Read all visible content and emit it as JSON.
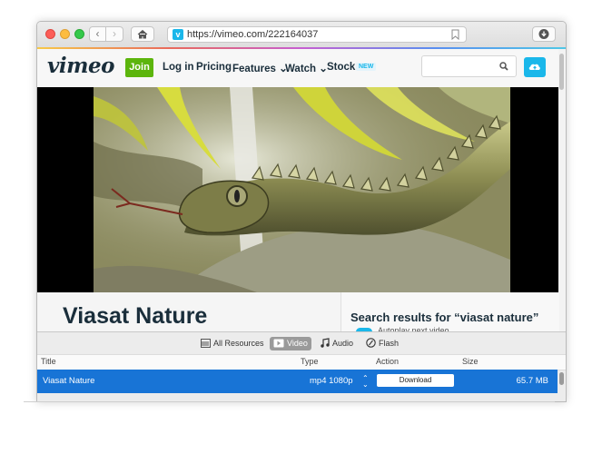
{
  "browser": {
    "url": "https://vimeo.com/222164037",
    "favicon_letter": "v"
  },
  "vimeo": {
    "logo": "vimeo",
    "join_label": "Join",
    "nav": [
      "Log in",
      "Pricing",
      "Features ⌄",
      "Watch ⌄",
      "Stock"
    ],
    "new_badge": "NEW",
    "search_placeholder": ""
  },
  "video": {
    "title": "Viasat Nature"
  },
  "sidebar": {
    "search_results": "Search results for “viasat nature”",
    "autoplay_label": "Autoplay next video"
  },
  "downloader": {
    "tabs": [
      "All Resources",
      "Video",
      "Audio",
      "Flash"
    ],
    "active_tab": "Video",
    "columns": [
      "Title",
      "Type",
      "Action",
      "Size"
    ],
    "rows": [
      {
        "title": "Viasat Nature",
        "type": "mp4 1080p",
        "action": "Download",
        "size": "65.7 MB"
      }
    ]
  },
  "colors": {
    "vimeo_green": "#5cb50c",
    "vimeo_blue": "#1ab7ea",
    "selection_blue": "#1874d6"
  }
}
